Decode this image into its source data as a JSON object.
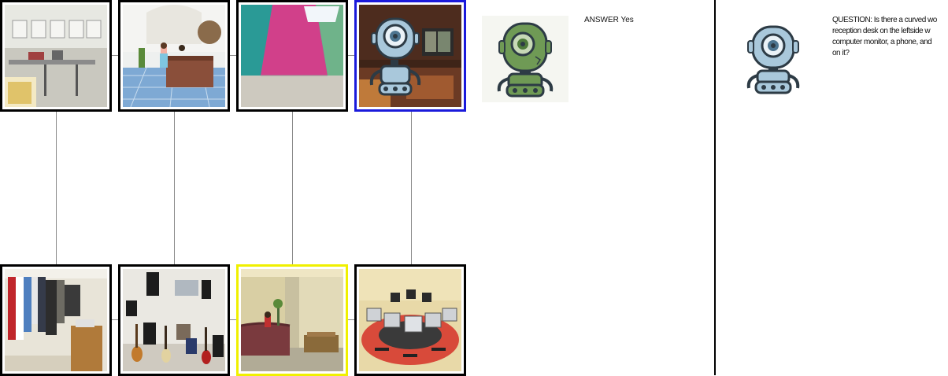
{
  "answer": {
    "text": "ANSWER Yes"
  },
  "question": {
    "text": "QUESTION: Is there a curved wo\nreception desk on the leftside w\ncomputer monitor, a phone, and\non it?"
  },
  "colors": {
    "active_frame": "#1a1adb",
    "target_frame": "#f0f000",
    "frame": "#000000",
    "connector": "#8a8a8a",
    "robot_green": "#6f9a55",
    "robot_blue": "#a9c8db"
  },
  "icons": {
    "answerer": "green-robot-icon",
    "questioner": "blue-robot-icon"
  },
  "top_row": [
    {
      "scene": "workshop-room"
    },
    {
      "scene": "hotel-reception-lobby"
    },
    {
      "scene": "pink-attic-room"
    },
    {
      "scene": "dark-living-room"
    }
  ],
  "bottom_row": [
    {
      "scene": "clothing-closet"
    },
    {
      "scene": "music-room-guitars"
    },
    {
      "scene": "reception-desk-office"
    },
    {
      "scene": "computer-lab-round-desk"
    }
  ]
}
